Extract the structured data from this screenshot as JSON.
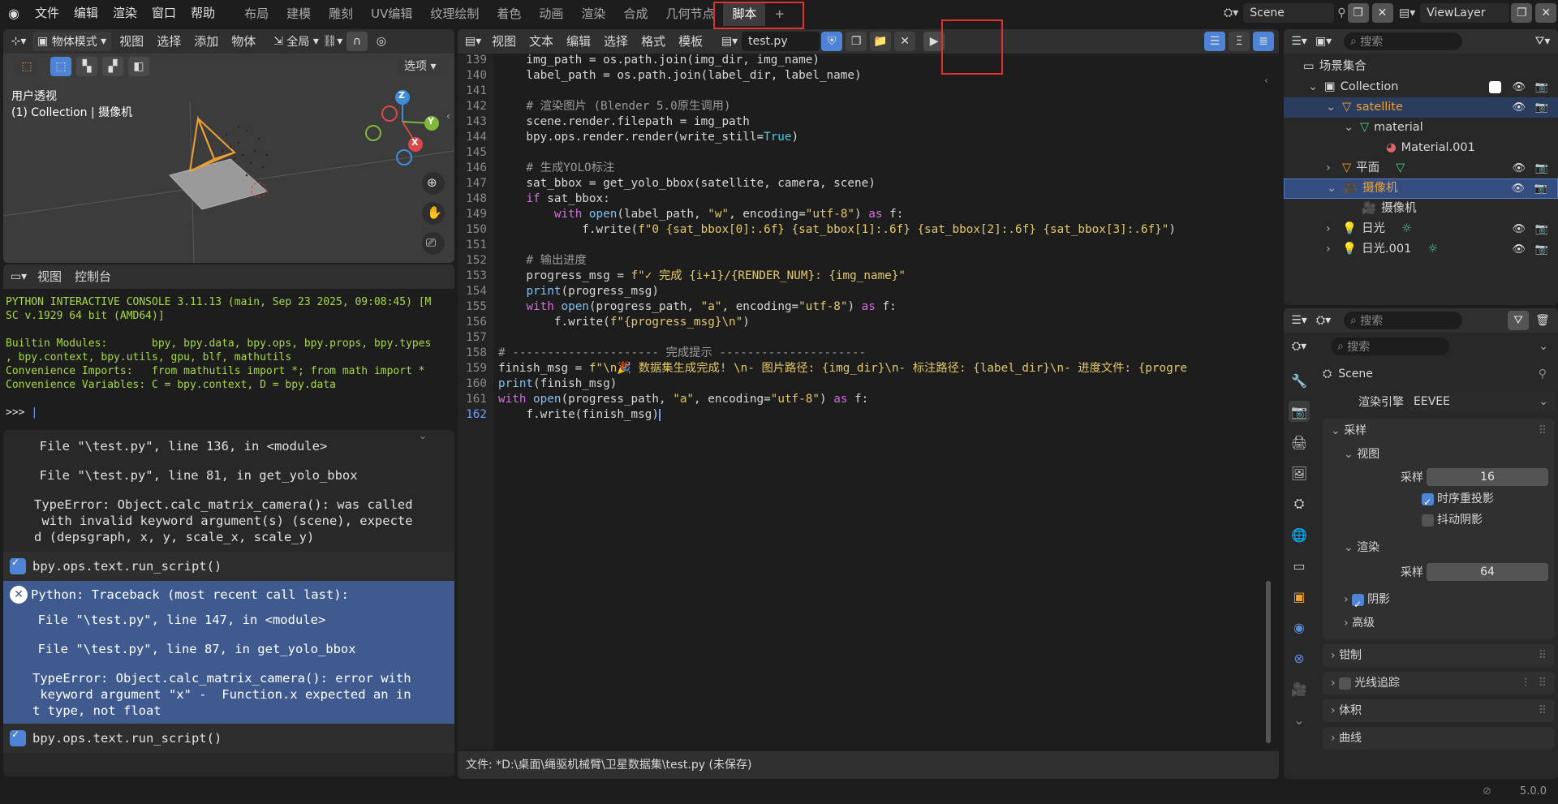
{
  "topbar": {
    "menus": [
      "文件",
      "编辑",
      "渲染",
      "窗口",
      "帮助"
    ],
    "workspaces": [
      "布局",
      "建模",
      "雕刻",
      "UV编辑",
      "纹理绘制",
      "着色",
      "动画",
      "渲染",
      "合成",
      "几何节点",
      "脚本"
    ],
    "active_workspace": "脚本",
    "add_tab": "+",
    "scene_name": "Scene",
    "view_layer": "ViewLayer"
  },
  "viewport": {
    "mode": "物体模式",
    "menus": [
      "视图",
      "选择",
      "添加",
      "物体"
    ],
    "orientation": "全局",
    "options_label": "选项",
    "view_name": "用户透视",
    "collection_info": "(1) Collection | 摄像机",
    "axes": {
      "x": "X",
      "y": "Y",
      "z": "Z"
    }
  },
  "console": {
    "menus": [
      "视图",
      "控制台"
    ],
    "lines": [
      "PYTHON INTERACTIVE CONSOLE 3.11.13 (main, Sep 23 2025, 09:08:45) [M",
      "SC v.1929 64 bit (AMD64)]",
      "",
      "Builtin Modules:       bpy, bpy.data, bpy.ops, bpy.props, bpy.types",
      ", bpy.context, bpy.utils, gpu, blf, mathutils",
      "Convenience Imports:   from mathutils import *; from math import *",
      "Convenience Variables: C = bpy.context, D = bpy.data"
    ],
    "prompt": ">>> "
  },
  "info": {
    "block1": [
      "  File \"\\test.py\", line 136, in <module>",
      "",
      "  File \"\\test.py\", line 81, in get_yolo_bbox",
      "",
      "TypeError: Object.calc_matrix_camera(): was called",
      " with invalid keyword argument(s) (scene), expecte",
      "d (depsgraph, x, y, scale_x, scale_y)"
    ],
    "op1": "bpy.ops.text.run_script()",
    "error_title": "Python: Traceback (most recent call last):",
    "block2": [
      "  File \"\\test.py\", line 147, in <module>",
      "",
      "  File \"\\test.py\", line 87, in get_yolo_bbox",
      "",
      "TypeError: Object.calc_matrix_camera(): error with",
      " keyword argument \"x\" -  Function.x expected an in",
      "t type, not float"
    ],
    "op2": "bpy.ops.text.run_script()"
  },
  "text_editor": {
    "menus": [
      "视图",
      "文本",
      "编辑",
      "选择",
      "格式",
      "模板"
    ],
    "filename": "test.py",
    "status": "文件: *D:\\桌面\\绳驱机械臂\\卫星数据集\\test.py (未保存)",
    "code": [
      {
        "n": "139",
        "t": "    img_path = os.path.join(img_dir, img_name)"
      },
      {
        "n": "140",
        "t": "    label_path = os.path.join(label_dir, label_name)"
      },
      {
        "n": "141",
        "t": ""
      },
      {
        "n": "142",
        "t": "    # 渲染图片 (Blender 5.0原生调用)"
      },
      {
        "n": "143",
        "t": "    scene.render.filepath = img_path"
      },
      {
        "n": "144",
        "t": "    bpy.ops.render.render(write_still=True)"
      },
      {
        "n": "145",
        "t": ""
      },
      {
        "n": "146",
        "t": "    # 生成YOLO标注"
      },
      {
        "n": "147",
        "t": "    sat_bbox = get_yolo_bbox(satellite, camera, scene)"
      },
      {
        "n": "148",
        "t": "    if sat_bbox:"
      },
      {
        "n": "149",
        "t": "        with open(label_path, \"w\", encoding=\"utf-8\") as f:"
      },
      {
        "n": "150",
        "t": "            f.write(f\"0 {sat_bbox[0]:.6f} {sat_bbox[1]:.6f} {sat_bbox[2]:.6f} {sat_bbox[3]:.6f}\")"
      },
      {
        "n": "151",
        "t": ""
      },
      {
        "n": "152",
        "t": "    # 输出进度"
      },
      {
        "n": "153",
        "t": "    progress_msg = f\"✓ 完成 {i+1}/{RENDER_NUM}: {img_name}\""
      },
      {
        "n": "154",
        "t": "    print(progress_msg)"
      },
      {
        "n": "155",
        "t": "    with open(progress_path, \"a\", encoding=\"utf-8\") as f:"
      },
      {
        "n": "156",
        "t": "        f.write(f\"{progress_msg}\\n\")"
      },
      {
        "n": "157",
        "t": ""
      },
      {
        "n": "158",
        "t": "# --------------------- 完成提示 ---------------------"
      },
      {
        "n": "159",
        "t": "finish_msg = f\"\\n🎉 数据集生成完成! \\n- 图片路径: {img_dir}\\n- 标注路径: {label_dir}\\n- 进度文件: {progre"
      },
      {
        "n": "160",
        "t": "print(finish_msg)"
      },
      {
        "n": "161",
        "t": "with open(progress_path, \"a\", encoding=\"utf-8\") as f:"
      },
      {
        "n": "162",
        "t": "    f.write(finish_msg)"
      }
    ]
  },
  "outliner": {
    "search_placeholder": "搜索",
    "root": "场景集合",
    "items": [
      {
        "label": "Collection",
        "indent": 1
      },
      {
        "label": "satellite",
        "indent": 2
      },
      {
        "label": "material",
        "indent": 3
      },
      {
        "label": "Material.001",
        "indent": 4
      },
      {
        "label": "平面",
        "indent": 2
      },
      {
        "label": "摄像机",
        "indent": 2
      },
      {
        "label": "摄像机",
        "indent": 3
      },
      {
        "label": "日光",
        "indent": 2
      },
      {
        "label": "日光.001",
        "indent": 2
      }
    ]
  },
  "properties": {
    "search_placeholder": "搜索",
    "scene_label": "Scene",
    "render_engine_label": "渲染引擎",
    "render_engine_value": "EEVEE",
    "sampling_panel": "采样",
    "viewport_sub": "视图",
    "samples_label": "采样",
    "viewport_samples": "16",
    "temporal_reprojection": "时序重投影",
    "jitter_shadows": "抖动阴影",
    "render_sub": "渲染",
    "render_samples": "64",
    "shadows": "阴影",
    "advanced": "高级",
    "clamping": "钳制",
    "raytracing": "光线追踪",
    "volumes": "体积",
    "curves": "曲线"
  },
  "statusbar": {
    "version": "5.0.0"
  },
  "colors": {
    "accent_blue": "#4e83d6",
    "selected_row": "#334d80",
    "error_block": "#3e5a8e",
    "highlight_box": "#e23030",
    "console_text": "#a6d945"
  }
}
